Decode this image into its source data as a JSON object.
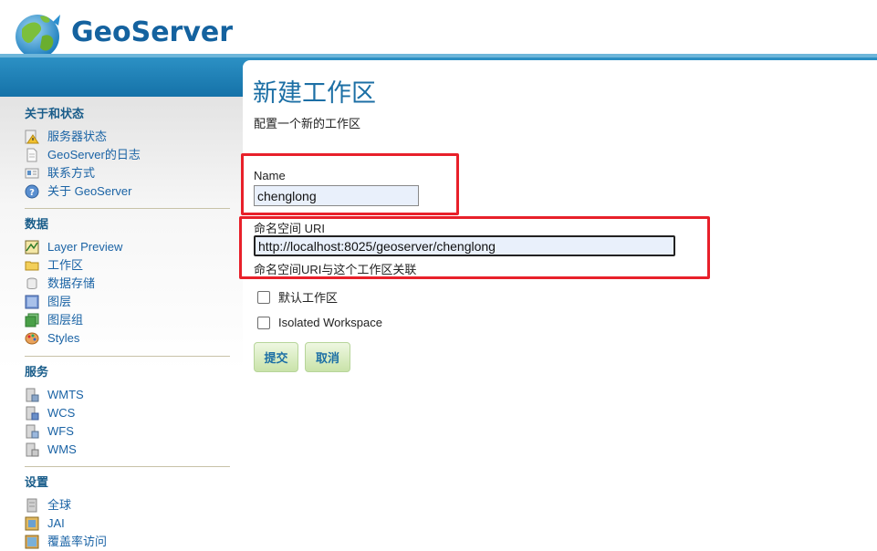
{
  "app": {
    "logo_text": "GeoServer",
    "logo_icon": "geoserver-globe-icon"
  },
  "colors": {
    "brand_blue": "#1c6fa5",
    "link": "#1a63a5",
    "highlight": "#e8202a",
    "button_green": "#c9e3a9"
  },
  "sidebar": {
    "sections": [
      {
        "title": "关于和状态",
        "items": [
          {
            "label": "服务器状态",
            "icon": "warning-icon"
          },
          {
            "label": "GeoServer的日志",
            "icon": "document-icon"
          },
          {
            "label": "联系方式",
            "icon": "contact-card-icon"
          },
          {
            "label": "关于 GeoServer",
            "icon": "help-icon"
          }
        ]
      },
      {
        "title": "数据",
        "items": [
          {
            "label": "Layer Preview",
            "icon": "map-preview-icon"
          },
          {
            "label": "工作区",
            "icon": "folder-icon"
          },
          {
            "label": "数据存储",
            "icon": "database-icon"
          },
          {
            "label": "图层",
            "icon": "layer-icon"
          },
          {
            "label": "图层组",
            "icon": "layer-group-icon"
          },
          {
            "label": "Styles",
            "icon": "palette-icon"
          }
        ]
      },
      {
        "title": "服务",
        "items": [
          {
            "label": "WMTS",
            "icon": "server-icon"
          },
          {
            "label": "WCS",
            "icon": "server-icon"
          },
          {
            "label": "WFS",
            "icon": "server-icon"
          },
          {
            "label": "WMS",
            "icon": "server-icon"
          }
        ]
      },
      {
        "title": "设置",
        "items": [
          {
            "label": "全球",
            "icon": "server-settings-icon"
          },
          {
            "label": "JAI",
            "icon": "jai-icon"
          },
          {
            "label": "覆盖率访问",
            "icon": "coverage-icon"
          }
        ]
      }
    ]
  },
  "main": {
    "title": "新建工作区",
    "subtitle": "配置一个新的工作区",
    "name_field": {
      "label": "Name",
      "value": "chenglong"
    },
    "uri_field": {
      "label": "命名空间 URI",
      "value": "http://localhost:8025/geoserver/chenglong",
      "help": "命名空间URI与这个工作区关联"
    },
    "default_checkbox": {
      "label": "默认工作区",
      "checked": false
    },
    "isolated_checkbox": {
      "label": "Isolated Workspace",
      "checked": false
    },
    "submit_label": "提交",
    "cancel_label": "取消"
  }
}
